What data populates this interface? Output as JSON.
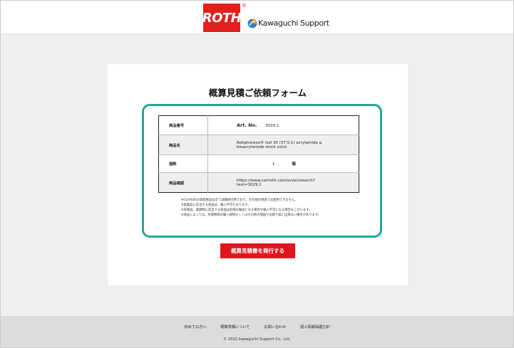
{
  "header": {
    "roth_logo_text": "ROTH",
    "roth_logo_reg": "®",
    "partner_name": "Kawaguchi Support"
  },
  "form": {
    "title": "概算見積ご依頼フォーム",
    "rows": [
      {
        "label": "商品番号",
        "prefix": "Art. No.",
        "value": "3029.1"
      },
      {
        "label": "商品名",
        "value_line1": "Rotiphorese® Gel 30 (37.5:1) acrylamide a.",
        "value_line2": "bisacrylamide stock solut."
      },
      {
        "label": "個数",
        "value": "1",
        "unit": "個"
      },
      {
        "label": "商品確認",
        "value_line1": "https://www.carlroth.com/en/en/search?",
        "value_line2": "text=3029.1"
      }
    ],
    "notes": [
      "※CarlRothの取扱製品は全て試験研究用であり、その他の用途では使用できません。",
      "※医薬品に該当する商品は、輸入不可となります。",
      "※危険品、毒劇物に該当する商品は危険な輸送となる場合や輸入不可となる場合もございます。",
      "※商品によっては、危険物等の輸入規制もしくはその他の理由でお取り扱い出来ない場合があります。"
    ],
    "submit_label": "概算見積書を発行する"
  },
  "footer": {
    "links": [
      "初めての方へ",
      "概算見積について",
      "お問い合わせ",
      "個人情報保護方針"
    ],
    "copyright": "© 2022 kawaguchi Support Co., Ltd."
  },
  "colors": {
    "brand_red": "#e2211c",
    "form_border": "#28a59a",
    "button_red": "#e2141d"
  }
}
